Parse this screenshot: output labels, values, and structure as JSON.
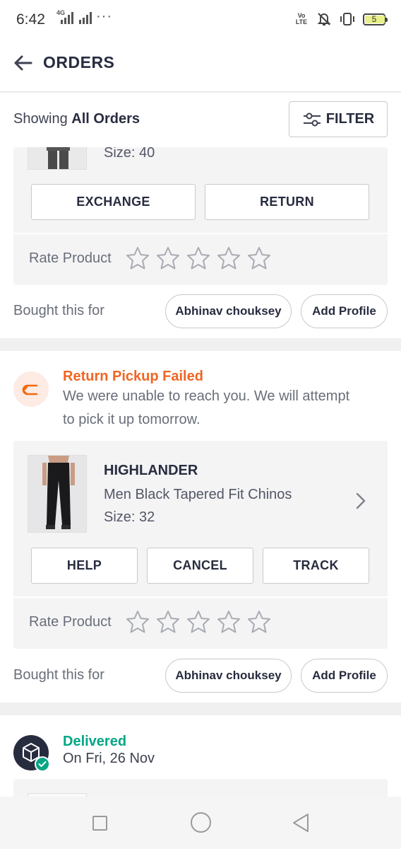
{
  "status_bar": {
    "time": "6:42",
    "signal_labels": "4G",
    "battery": "5",
    "volte": "VoLTE2"
  },
  "header": {
    "title": "ORDERS"
  },
  "filter_bar": {
    "showing_prefix": "Showing",
    "showing_value": "All Orders",
    "filter_label": "FILTER"
  },
  "order1": {
    "size": "Size: 40",
    "buttons": [
      "EXCHANGE",
      "RETURN"
    ],
    "rate_label": "Rate Product",
    "bought_for": "Bought this for",
    "profile": "Abhinav chouksey",
    "add_profile": "Add Profile"
  },
  "order2": {
    "status_title": "Return Pickup Failed",
    "status_line1": "We were unable to reach you. We will attempt",
    "status_line2": "to pick it up tomorrow.",
    "brand": "HIGHLANDER",
    "name": "Men Black Tapered Fit Chinos",
    "size": "Size: 32",
    "buttons": [
      "HELP",
      "CANCEL",
      "TRACK"
    ],
    "rate_label": "Rate Product",
    "bought_for": "Bought this for",
    "profile": "Abhinav chouksey",
    "add_profile": "Add Profile",
    "status_color": "#f16565"
  },
  "order3": {
    "status_title": "Delivered",
    "status_date": "On Fri, 26 Nov",
    "status_color": "#03a685"
  },
  "icons": [
    "back-arrow-icon",
    "filter-sliders-icon",
    "return-arrow-icon",
    "star-outline-icon",
    "chevron-right-icon",
    "package-box-icon",
    "check-badge-icon"
  ]
}
